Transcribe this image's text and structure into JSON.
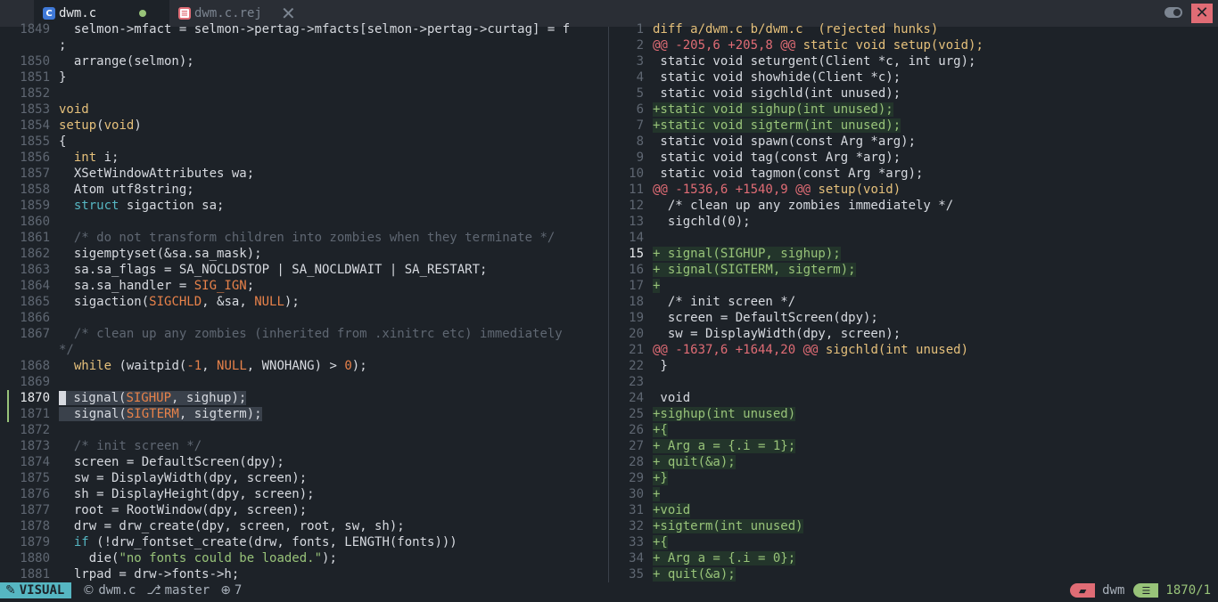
{
  "tabs": [
    {
      "label": "dwm.c",
      "icon": "c-file-icon",
      "modified": true,
      "active": true
    },
    {
      "label": "dwm.c.rej",
      "icon": "rej-file-icon",
      "modified": false,
      "active": false
    }
  ],
  "window": {
    "close_symbol": "✕"
  },
  "left": {
    "lines": [
      {
        "n": "1849",
        "html": "  selmon-&gt;mfact = selmon-&gt;pertag-&gt;mfacts[selmon-&gt;pertag-&gt;curtag] = f"
      },
      {
        "n": "",
        "html": ";"
      },
      {
        "n": "1850",
        "html": "  arrange(selmon);"
      },
      {
        "n": "1851",
        "html": "}"
      },
      {
        "n": "1852",
        "html": ""
      },
      {
        "n": "1853",
        "html": "<span class=\"kw\">void</span>"
      },
      {
        "n": "1854",
        "html": "<span class=\"kw\">setup</span>(<span class=\"kw\">void</span>)"
      },
      {
        "n": "1855",
        "html": "{"
      },
      {
        "n": "1856",
        "html": "  <span class=\"kw\">int</span> i;"
      },
      {
        "n": "1857",
        "html": "  XSetWindowAttributes wa;"
      },
      {
        "n": "1858",
        "html": "  Atom utf8string;"
      },
      {
        "n": "1859",
        "html": "  <span class=\"ty\">struct</span> sigaction sa;"
      },
      {
        "n": "1860",
        "html": ""
      },
      {
        "n": "1861",
        "html": "  <span class=\"cm\">/* do not transform children into zombies when they terminate */</span>"
      },
      {
        "n": "1862",
        "html": "  sigemptyset(&amp;sa.sa_mask);"
      },
      {
        "n": "1863",
        "html": "  sa.sa_flags = SA_NOCLDSTOP | SA_NOCLDWAIT | SA_RESTART;"
      },
      {
        "n": "1864",
        "html": "  sa.sa_handler = <span class=\"or\">SIG_IGN</span>;"
      },
      {
        "n": "1865",
        "html": "  sigaction(<span class=\"or\">SIGCHLD</span>, &amp;sa, <span class=\"or\">NULL</span>);"
      },
      {
        "n": "1866",
        "html": ""
      },
      {
        "n": "1867",
        "html": "  <span class=\"cm\">/* clean up any zombies (inherited from .xinitrc etc) immediately</span>"
      },
      {
        "n": "",
        "html": "<span class=\"cm\">*/</span>"
      },
      {
        "n": "1868",
        "html": "  <span class=\"kw\">while</span> (waitpid(<span class=\"or\">-1</span>, <span class=\"or\">NULL</span>, WNOHANG) &gt; <span class=\"or\">0</span>);"
      },
      {
        "n": "1869",
        "html": ""
      },
      {
        "n": "1870",
        "html": "<span class=\"cursor-block\"></span><span class=\"visual-sel\"> signal(<span class=\"or\">SIGHUP</span>, sighup);</span>",
        "cur": true,
        "mark": true
      },
      {
        "n": "1871",
        "html": "<span class=\"visual-sel\">  signal(<span class=\"or\">SIGTERM</span>, sigterm);</span>",
        "mark": true
      },
      {
        "n": "1872",
        "html": ""
      },
      {
        "n": "1873",
        "html": "  <span class=\"cm\">/* init screen */</span>"
      },
      {
        "n": "1874",
        "html": "  screen = DefaultScreen(dpy);"
      },
      {
        "n": "1875",
        "html": "  sw = DisplayWidth(dpy, screen);"
      },
      {
        "n": "1876",
        "html": "  sh = DisplayHeight(dpy, screen);"
      },
      {
        "n": "1877",
        "html": "  root = RootWindow(dpy, screen);"
      },
      {
        "n": "1878",
        "html": "  drw = drw_create(dpy, screen, root, sw, sh);"
      },
      {
        "n": "1879",
        "html": "  <span class=\"ty\">if</span> (!drw_fontset_create(drw, fonts, LENGTH(fonts)))"
      },
      {
        "n": "1880",
        "html": "    die(<span class=\"str\">\"no fonts could be loaded.\"</span>);"
      },
      {
        "n": "1881",
        "html": "  lrpad = drw-&gt;fonts-&gt;h;"
      }
    ]
  },
  "right": {
    "lines": [
      {
        "n": "1",
        "html": "<span class=\"diff-head\">diff a/dwm.c b/dwm.c  (rejected hunks)</span>"
      },
      {
        "n": "2",
        "html": "<span class=\"hunk-at\">@@ -205,6 +205,8 @@</span><span class=\"hunk-ctx\"> static void setup(void);</span>"
      },
      {
        "n": "3",
        "html": " static void seturgent(Client *c, int urg);"
      },
      {
        "n": "4",
        "html": " static void showhide(Client *c);"
      },
      {
        "n": "5",
        "html": " static void sigchld(int unused);"
      },
      {
        "n": "6",
        "html": "<span class=\"added\">+static void sighup(int unused);</span>"
      },
      {
        "n": "7",
        "html": "<span class=\"added\">+static void sigterm(int unused);</span>"
      },
      {
        "n": "8",
        "html": " static void spawn(const Arg *arg);"
      },
      {
        "n": "9",
        "html": " static void tag(const Arg *arg);"
      },
      {
        "n": "10",
        "html": " static void tagmon(const Arg *arg);"
      },
      {
        "n": "11",
        "html": "<span class=\"hunk-at\">@@ -1536,6 +1540,9 @@</span><span class=\"hunk-ctx\"> setup(void)</span>"
      },
      {
        "n": "12",
        "html": "  /* clean up any zombies immediately */"
      },
      {
        "n": "13",
        "html": "  sigchld(0);"
      },
      {
        "n": "14",
        "html": ""
      },
      {
        "n": "15",
        "html": "<span class=\"added\">+ signal(SIGHUP, sighup);</span>",
        "cur": true
      },
      {
        "n": "16",
        "html": "<span class=\"added\">+ signal(SIGTERM, sigterm);</span>"
      },
      {
        "n": "17",
        "html": "<span class=\"added\">+</span>"
      },
      {
        "n": "18",
        "html": "  /* init screen */"
      },
      {
        "n": "19",
        "html": "  screen = DefaultScreen(dpy);"
      },
      {
        "n": "20",
        "html": "  sw = DisplayWidth(dpy, screen);"
      },
      {
        "n": "21",
        "html": "<span class=\"hunk-at\">@@ -1637,6 +1644,20 @@</span><span class=\"hunk-ctx\"> sigchld(int unused)</span>"
      },
      {
        "n": "22",
        "html": " }"
      },
      {
        "n": "23",
        "html": ""
      },
      {
        "n": "24",
        "html": " void"
      },
      {
        "n": "25",
        "html": "<span class=\"added\">+sighup(int unused)</span>"
      },
      {
        "n": "26",
        "html": "<span class=\"added\">+{</span>"
      },
      {
        "n": "27",
        "html": "<span class=\"added\">+ Arg a = {.i = 1};</span>"
      },
      {
        "n": "28",
        "html": "<span class=\"added\">+ quit(&amp;a);</span>"
      },
      {
        "n": "29",
        "html": "<span class=\"added\">+}</span>"
      },
      {
        "n": "30",
        "html": "<span class=\"added\">+</span>"
      },
      {
        "n": "31",
        "html": "<span class=\"added\">+void</span>"
      },
      {
        "n": "32",
        "html": "<span class=\"added\">+sigterm(int unused)</span>"
      },
      {
        "n": "33",
        "html": "<span class=\"added\">+{</span>"
      },
      {
        "n": "34",
        "html": "<span class=\"added\">+ Arg a = {.i = 0};</span>"
      },
      {
        "n": "35",
        "html": "<span class=\"added\">+ quit(&amp;a);</span>"
      }
    ]
  },
  "statusbar": {
    "mode": "VISUAL",
    "file": "dwm.c",
    "branch": "master",
    "changes": "7",
    "project": "dwm",
    "position": "1870/1"
  },
  "colors": {
    "background": "#1d2228",
    "accent_mode": "#56b6c2",
    "added": "#98c379",
    "hunk": "#e06c75",
    "keyword": "#e5c07b"
  }
}
